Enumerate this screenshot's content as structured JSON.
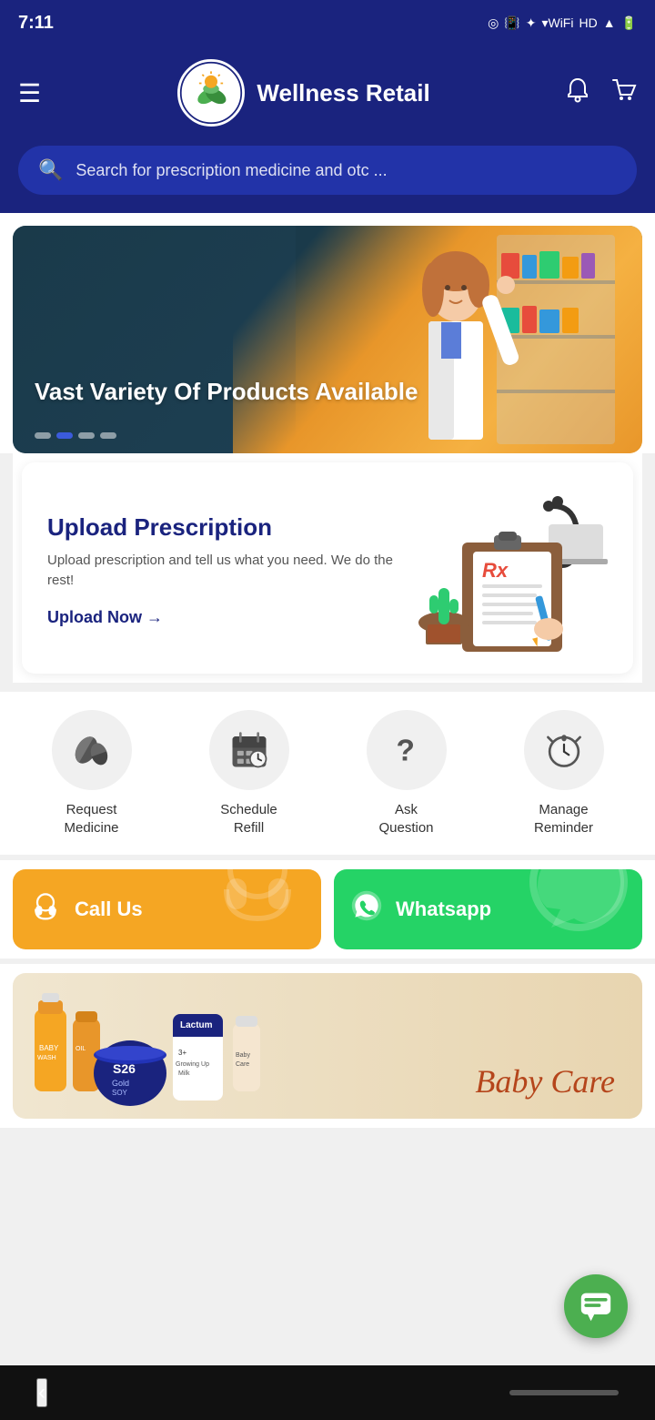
{
  "statusBar": {
    "time": "7:11",
    "icons": "📳 ✦ 🌐 HD 📶 🔋"
  },
  "header": {
    "menuIcon": "☰",
    "brandName": "Wellness Retail",
    "bellIcon": "🔔",
    "cartIcon": "🛒"
  },
  "search": {
    "placeholder": "Search for prescription medicine and otc ...",
    "icon": "🔍"
  },
  "banner": {
    "text": "Vast Variety Of\nProducts Available",
    "dots": [
      "inactive",
      "active",
      "inactive",
      "inactive"
    ]
  },
  "uploadPrescription": {
    "title": "Upload Prescription",
    "description": "Upload prescription and tell us what you need. We do the rest!",
    "uploadLinkText": "Upload Now →"
  },
  "quickActions": [
    {
      "id": "request-medicine",
      "icon": "💊",
      "label": "Request\nMedicine"
    },
    {
      "id": "schedule-refill",
      "icon": "📅",
      "label": "Schedule\nRefill"
    },
    {
      "id": "ask-question",
      "icon": "❓",
      "label": "Ask\nQuestion"
    },
    {
      "id": "manage-reminder",
      "icon": "⏰",
      "label": "Manage\nReminder"
    }
  ],
  "contactButtons": [
    {
      "id": "call-us",
      "icon": "🎧",
      "label": "Call Us",
      "bgIcon": "🎧",
      "type": "call"
    },
    {
      "id": "whatsapp",
      "icon": "📱",
      "label": "Whatsapp",
      "bgIcon": "📱",
      "type": "whatsapp"
    }
  ],
  "babyCare": {
    "text": "Baby Care"
  },
  "chatFab": {
    "icon": "💬"
  }
}
